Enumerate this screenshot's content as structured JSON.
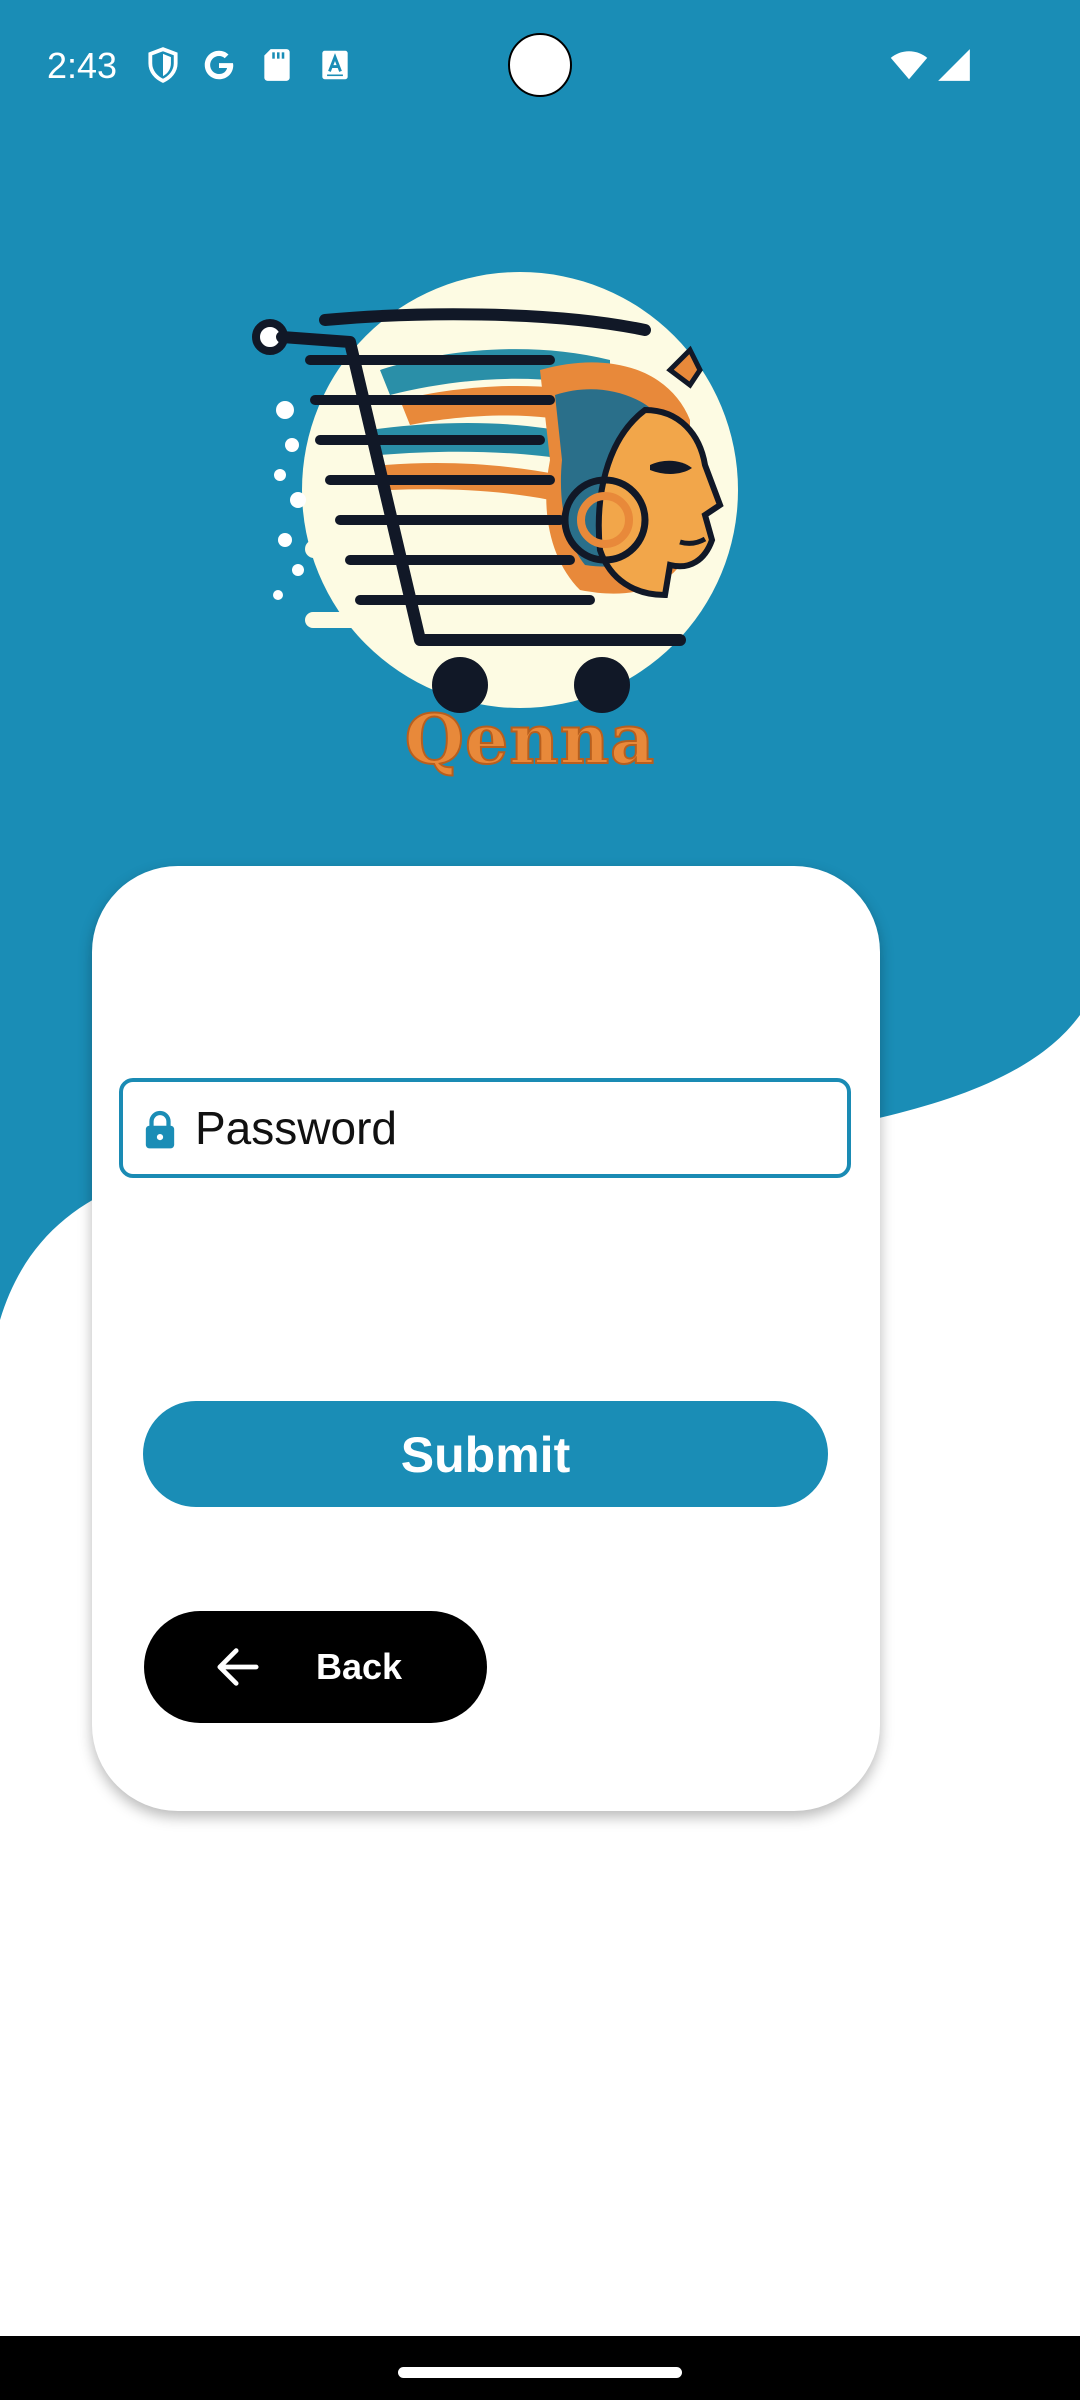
{
  "status_bar": {
    "time": "2:43",
    "icons": [
      "shield-icon",
      "google-icon",
      "sd-card-icon",
      "font-icon",
      "wifi-icon",
      "signal-icon"
    ]
  },
  "brand": {
    "name": "Qenna",
    "logo_icon": "shopping-cart-pharaoh-logo"
  },
  "login_form": {
    "password_placeholder": "Password",
    "password_icon": "lock-icon",
    "submit_label": "Submit",
    "back_label": "Back",
    "back_icon": "arrow-left-icon"
  },
  "colors": {
    "primary": "#1A8DB6",
    "back_button": "#000000",
    "brand_text": "#E8893A",
    "background": "#FFFFFF"
  }
}
